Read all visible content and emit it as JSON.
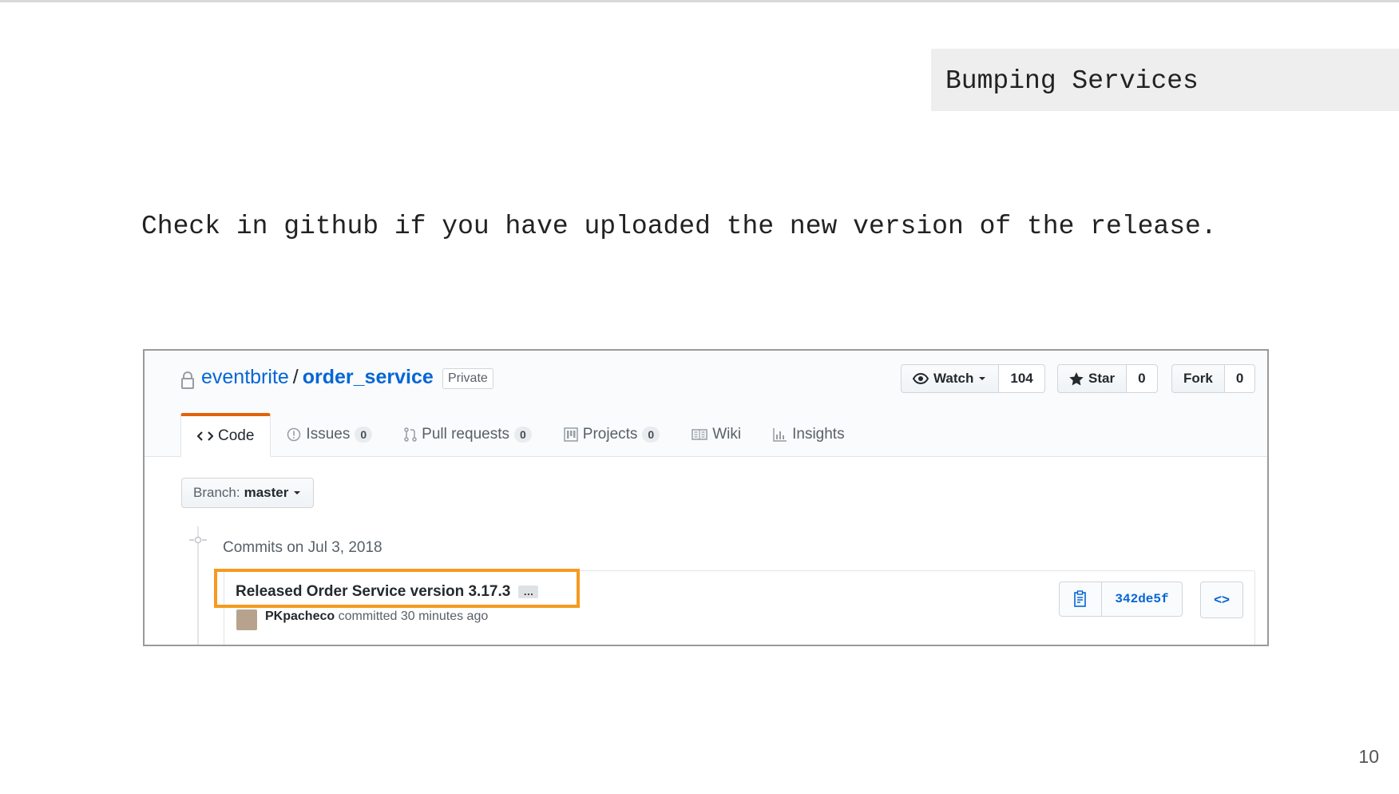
{
  "slide": {
    "section_title": "Bumping Services",
    "instruction": "Check in github if you have uploaded the new version of the release.",
    "page_number": "10"
  },
  "repo": {
    "owner": "eventbrite",
    "separator": "/",
    "name": "order_service",
    "visibility": "Private"
  },
  "actions": {
    "watch_label": "Watch",
    "watch_count": "104",
    "star_label": "Star",
    "star_count": "0",
    "fork_label": "Fork",
    "fork_count": "0"
  },
  "tabs": [
    {
      "label": "Code",
      "icon": "code-icon"
    },
    {
      "label": "Issues",
      "count": "0",
      "icon": "issue-icon"
    },
    {
      "label": "Pull requests",
      "count": "0",
      "icon": "pull-request-icon"
    },
    {
      "label": "Projects",
      "count": "0",
      "icon": "project-icon"
    },
    {
      "label": "Wiki",
      "icon": "book-icon"
    },
    {
      "label": "Insights",
      "icon": "graph-icon"
    }
  ],
  "branch": {
    "prefix": "Branch:",
    "name": "master"
  },
  "commits": {
    "heading": "Commits on Jul 3, 2018",
    "items": [
      {
        "message": "Released Order Service version 3.17.3",
        "ellipsis": "…",
        "author": "PKpacheco",
        "time_text": "committed 30 minutes ago",
        "sha": "342de5f",
        "browse_label": "<>"
      }
    ]
  },
  "colors": {
    "highlight": "#f79a1e",
    "link": "#0366d6",
    "active_tab_border": "#e36209"
  }
}
